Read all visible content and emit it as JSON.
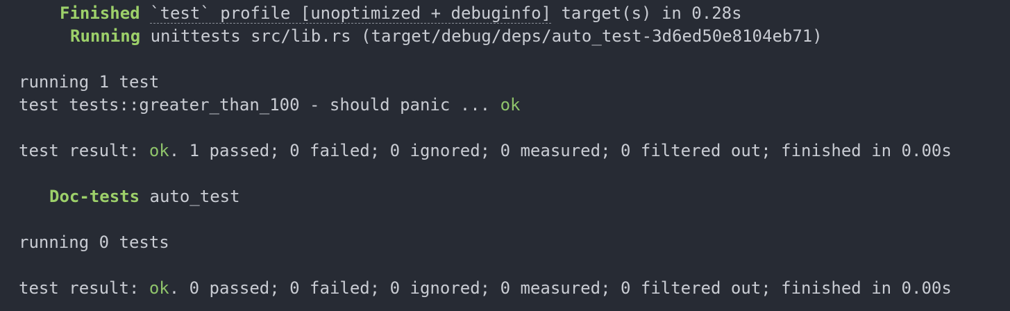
{
  "terminal": {
    "lines": {
      "finished": {
        "keyword": "Finished",
        "profile": "`test` profile [unoptimized + debuginfo]",
        "rest": " target(s) in 0.28s"
      },
      "running": {
        "keyword": "Running",
        "text": " unittests src/lib.rs (target/debug/deps/auto_test-3d6ed50e8104eb71)"
      },
      "running_count_1": "running 1 test",
      "test_case": {
        "text": "test tests::greater_than_100 - should panic ... ",
        "status": "ok"
      },
      "result_1": {
        "prefix": "test result: ",
        "status": "ok",
        "rest": ". 1 passed; 0 failed; 0 ignored; 0 measured; 0 filtered out; finished in 0.00s"
      },
      "doc_tests": {
        "keyword": "Doc-tests",
        "text": " auto_test"
      },
      "running_count_0": "running 0 tests",
      "result_2": {
        "prefix": "test result: ",
        "status": "ok",
        "rest": ". 0 passed; 0 failed; 0 ignored; 0 measured; 0 filtered out; finished in 0.00s"
      }
    },
    "colors": {
      "background": "#272b34",
      "text": "#c9ccd3",
      "keyword": "#9dd06a",
      "ok": "#8fc46b"
    }
  }
}
